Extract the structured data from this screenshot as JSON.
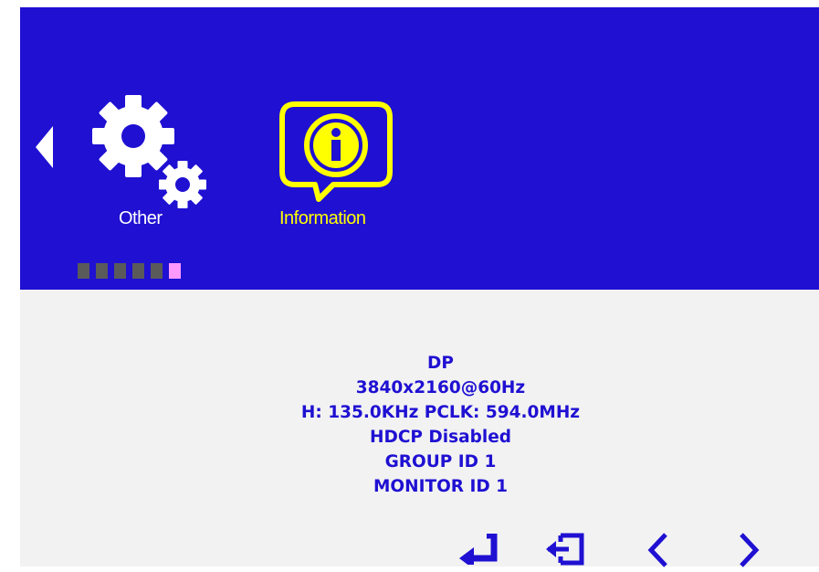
{
  "menu": {
    "items": [
      {
        "label": "Other",
        "icon": "gear-icon",
        "selected": false
      },
      {
        "label": "Information",
        "icon": "info-icon",
        "selected": true
      }
    ],
    "left_arrow_icon": "triangle-left-icon",
    "page_indicator": {
      "count": 6,
      "active_index": 5
    }
  },
  "info": {
    "lines": [
      "DP",
      "3840x2160@60Hz",
      "H: 135.0KHz PCLK: 594.0MHz",
      "HDCP Disabled",
      "GROUP ID 1",
      "MONITOR ID 1"
    ]
  },
  "nav_icons": [
    "enter-icon",
    "exit-icon",
    "chevron-left-icon",
    "chevron-right-icon"
  ],
  "colors": {
    "panel_blue": "#1f10d2",
    "background_gray": "#f2f2f2",
    "selected_yellow": "#ffff00",
    "text_white": "#ffffff",
    "dot_inactive": "#5a5a5a",
    "dot_active": "#ff99ff"
  }
}
